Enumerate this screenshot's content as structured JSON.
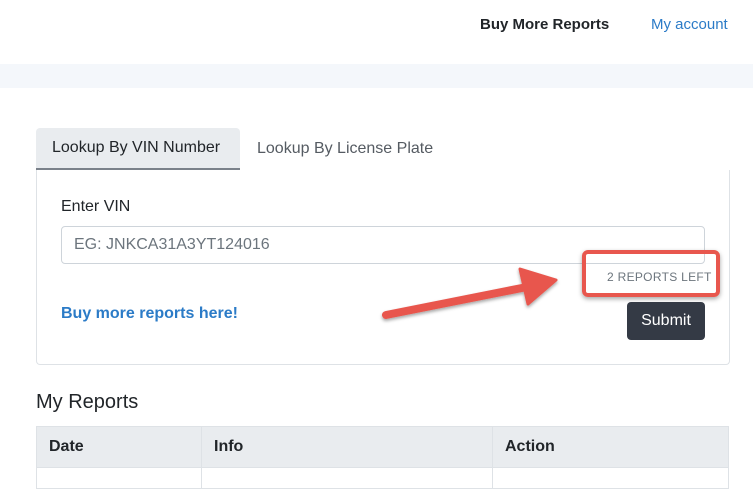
{
  "nav": {
    "buy_more_reports": "Buy More Reports",
    "my_account": "My account"
  },
  "tabs": [
    {
      "label": "Lookup By VIN Number",
      "active": true
    },
    {
      "label": "Lookup By License Plate",
      "active": false
    }
  ],
  "form": {
    "vin_label": "Enter VIN",
    "vin_placeholder": "EG: JNKCA31A3YT124016",
    "vin_value": "",
    "reports_left": "2 REPORTS LEFT",
    "buy_more_link": "Buy more reports here!",
    "submit_label": "Submit"
  },
  "annotation": {
    "highlight_color": "#e8574e"
  },
  "reports": {
    "title": "My Reports",
    "columns": [
      "Date",
      "Info",
      "Action"
    ],
    "rows": []
  },
  "colors": {
    "link": "#2b7bc7",
    "submit_bg": "#343a45",
    "tab_active_bg": "#e9ecef"
  }
}
